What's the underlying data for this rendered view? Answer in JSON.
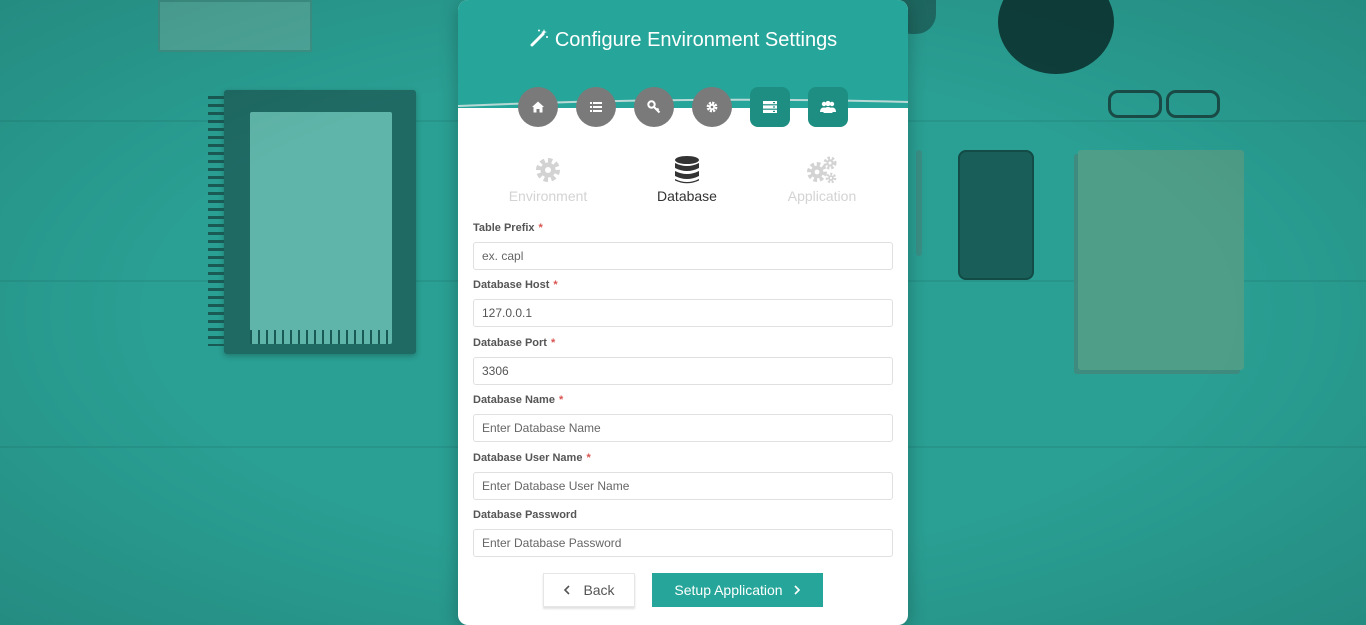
{
  "header": {
    "title": "Configure Environment Settings"
  },
  "steps": [
    {
      "name": "home",
      "icon": "home-icon",
      "active": false
    },
    {
      "name": "requirements",
      "icon": "list-icon",
      "active": false
    },
    {
      "name": "permissions",
      "icon": "key-icon",
      "active": false
    },
    {
      "name": "settings",
      "icon": "gear-icon",
      "active": false
    },
    {
      "name": "environment",
      "icon": "server-icon",
      "active": true
    },
    {
      "name": "users",
      "icon": "users-icon",
      "active": true
    }
  ],
  "tabs": {
    "environment": {
      "label": "Environment",
      "icon": "gear-icon",
      "active": false
    },
    "database": {
      "label": "Database",
      "icon": "database-icon",
      "active": true
    },
    "application": {
      "label": "Application",
      "icon": "gears-icon",
      "active": false
    }
  },
  "form": {
    "table_prefix": {
      "label": "Table Prefix",
      "required_mark": "*",
      "value": "",
      "placeholder": "ex. capl"
    },
    "db_host": {
      "label": "Database Host",
      "required_mark": "*",
      "value": "127.0.0.1",
      "placeholder": ""
    },
    "db_port": {
      "label": "Database Port",
      "required_mark": "*",
      "value": "3306",
      "placeholder": ""
    },
    "db_name": {
      "label": "Database Name",
      "required_mark": "*",
      "value": "",
      "placeholder": "Enter Database Name"
    },
    "db_user": {
      "label": "Database User Name",
      "required_mark": "*",
      "value": "",
      "placeholder": "Enter Database User Name"
    },
    "db_password": {
      "label": "Database Password",
      "value": "",
      "placeholder": "Enter Database Password"
    }
  },
  "buttons": {
    "back_label": "Back",
    "next_label": "Setup Application"
  },
  "colors": {
    "accent": "#26a69a",
    "accent_dark": "#1e8e82",
    "step_inactive": "#7a7a7a",
    "required": "#d9534f"
  }
}
